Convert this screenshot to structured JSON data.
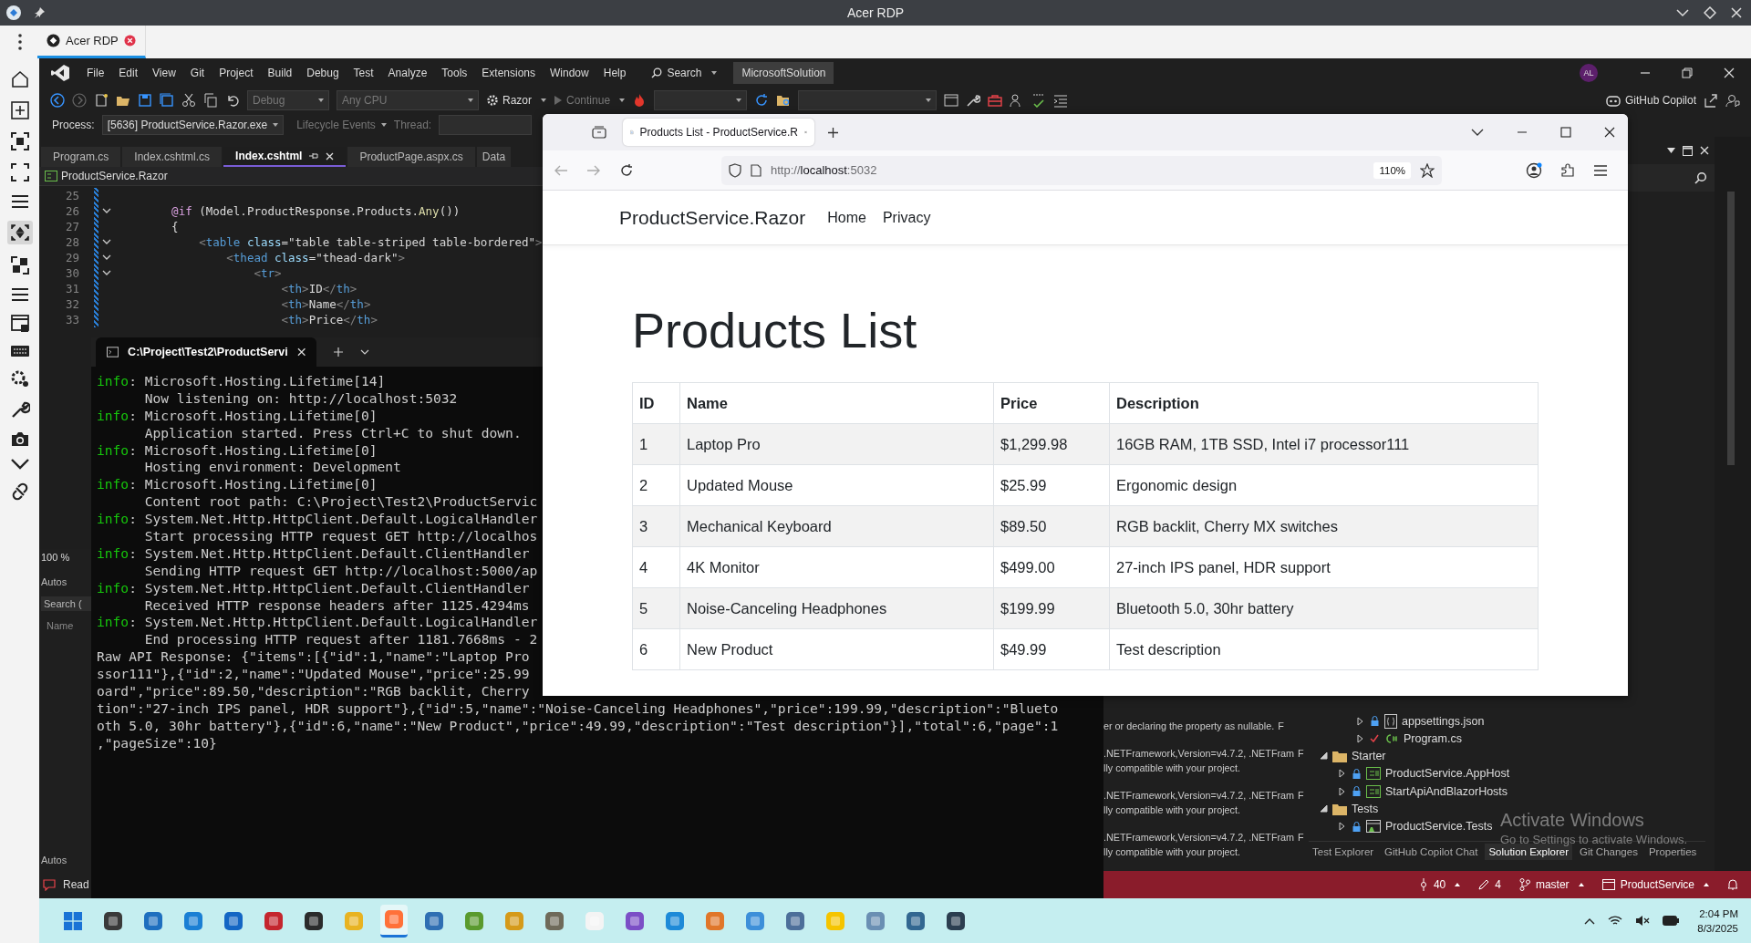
{
  "rdp": {
    "title": "Acer RDP",
    "tab": "Acer RDP"
  },
  "vs": {
    "menu": [
      "File",
      "Edit",
      "View",
      "Git",
      "Project",
      "Build",
      "Debug",
      "Test",
      "Analyze",
      "Tools",
      "Extensions",
      "Window",
      "Help"
    ],
    "search": "Search",
    "solution": "MicrosoftSolution",
    "account": "AL",
    "configuration": "Debug",
    "platform": "Any CPU",
    "startup": "Razor",
    "continue": "Continue",
    "copilot": "GitHub Copilot",
    "process_label": "Process:",
    "process": "[5636] ProductService.Razor.exe",
    "lifecycle": "Lifecycle Events",
    "thread_label": "Thread:",
    "doc_tabs": [
      {
        "label": "Program.cs",
        "selected": false
      },
      {
        "label": "Index.cshtml.cs",
        "selected": false
      },
      {
        "label": "Index.cshtml",
        "selected": true
      },
      {
        "label": "ProductPage.aspx.cs",
        "selected": false
      },
      {
        "label": "Data",
        "selected": false
      }
    ],
    "breadcrumb": "ProductService.Razor",
    "code": [
      {
        "number": "25",
        "foldable": false
      },
      {
        "number": "26",
        "foldable": true,
        "segments": [
          {
            "kind": "keyword",
            "text": "    @if"
          },
          {
            "kind": "plain",
            "text": " (Model.ProductResponse.Products."
          },
          {
            "kind": "method",
            "text": "Any"
          },
          {
            "kind": "plain",
            "text": "())"
          }
        ]
      },
      {
        "number": "27",
        "foldable": false,
        "segments": [
          {
            "kind": "plain",
            "text": "    {"
          }
        ]
      },
      {
        "number": "28",
        "foldable": true,
        "segments": [
          {
            "kind": "punct",
            "text": "        <"
          },
          {
            "kind": "tag",
            "text": "table"
          },
          {
            "kind": "attr",
            "text": " class"
          },
          {
            "kind": "plain",
            "text": "="
          },
          {
            "kind": "string",
            "text": "\"table table-striped table-bordered\""
          },
          {
            "kind": "punct",
            "text": ">"
          }
        ]
      },
      {
        "number": "29",
        "foldable": true,
        "segments": [
          {
            "kind": "punct",
            "text": "            <"
          },
          {
            "kind": "tag",
            "text": "thead"
          },
          {
            "kind": "attr",
            "text": " class"
          },
          {
            "kind": "plain",
            "text": "="
          },
          {
            "kind": "string",
            "text": "\"thead-dark\""
          },
          {
            "kind": "punct",
            "text": ">"
          }
        ]
      },
      {
        "number": "30",
        "foldable": true,
        "segments": [
          {
            "kind": "punct",
            "text": "                <"
          },
          {
            "kind": "tag",
            "text": "tr"
          },
          {
            "kind": "punct",
            "text": ">"
          }
        ]
      },
      {
        "number": "31",
        "foldable": false,
        "segments": [
          {
            "kind": "punct",
            "text": "                    <"
          },
          {
            "kind": "tag",
            "text": "th"
          },
          {
            "kind": "punct",
            "text": ">"
          },
          {
            "kind": "plain",
            "text": "ID"
          },
          {
            "kind": "punct",
            "text": "</"
          },
          {
            "kind": "tag",
            "text": "th"
          },
          {
            "kind": "punct",
            "text": ">"
          }
        ]
      },
      {
        "number": "32",
        "foldable": false,
        "segments": [
          {
            "kind": "punct",
            "text": "                    <"
          },
          {
            "kind": "tag",
            "text": "th"
          },
          {
            "kind": "punct",
            "text": ">"
          },
          {
            "kind": "plain",
            "text": "Name"
          },
          {
            "kind": "punct",
            "text": "</"
          },
          {
            "kind": "tag",
            "text": "th"
          },
          {
            "kind": "punct",
            "text": ">"
          }
        ]
      },
      {
        "number": "33",
        "foldable": false,
        "segments": [
          {
            "kind": "punct",
            "text": "                    <"
          },
          {
            "kind": "tag",
            "text": "th"
          },
          {
            "kind": "punct",
            "text": ">"
          },
          {
            "kind": "plain",
            "text": "Price"
          },
          {
            "kind": "punct",
            "text": "</"
          },
          {
            "kind": "tag",
            "text": "th"
          },
          {
            "kind": "punct",
            "text": ">"
          }
        ]
      }
    ],
    "zoom": "100 %",
    "autos": {
      "title": "Autos",
      "search": "Search (",
      "column": "Name",
      "footer_tab": "Autos"
    },
    "errors": [
      {
        "text": "er or declaring the property as nullable.",
        "column_2": "F"
      },
      {
        "text": ".NETFramework,Version=v4.7.2, .NETFram",
        "column_2": "F"
      },
      {
        "text": "lly compatible with your project."
      },
      {
        "text": ".NETFramework,Version=v4.7.2, .NETFram",
        "column_2": "F"
      },
      {
        "text": "lly compatible with your project."
      },
      {
        "text": ".NETFramework,Version=v4.7.2, .NETFram",
        "column_2": "F"
      },
      {
        "text": "lly compatible with your project."
      }
    ],
    "solution_explorer": {
      "nested_items": [
        {
          "label": "appsettings.json",
          "kind": "json",
          "locked": true,
          "modified": false,
          "expanded": false
        },
        {
          "label": "Program.cs",
          "kind": "csharp",
          "locked": false,
          "modified": true,
          "expanded": false
        }
      ],
      "tree": [
        {
          "label": "Starter",
          "kind": "folder",
          "expanded": true,
          "children": [
            {
              "label": "ProductService.AppHost",
              "kind": "project",
              "locked": true,
              "expanded": false
            },
            {
              "label": "StartApiAndBlazorHosts",
              "kind": "project",
              "locked": true,
              "expanded": false
            }
          ]
        },
        {
          "label": "Tests",
          "kind": "folder",
          "expanded": true,
          "children": [
            {
              "label": "ProductService.Tests",
              "kind": "test",
              "locked": true,
              "expanded": false
            }
          ]
        }
      ],
      "tabs": [
        {
          "label": "Test Explorer",
          "selected": false
        },
        {
          "label": "GitHub Copilot Chat",
          "selected": false
        },
        {
          "label": "Solution Explorer",
          "selected": true
        },
        {
          "label": "Git Changes",
          "selected": false
        },
        {
          "label": "Properties",
          "selected": false
        }
      ]
    },
    "status": {
      "left": "Read",
      "errors": "40",
      "edits": "4",
      "branch": "master",
      "repo": "ProductService"
    }
  },
  "terminal": {
    "tab": "C:\\Project\\Test2\\ProductServi",
    "lines": [
      {
        "kind": "log",
        "tag": "info",
        "text": ": Microsoft.Hosting.Lifetime[14]"
      },
      {
        "kind": "plain",
        "text": "      Now listening on: http://localhost:5032"
      },
      {
        "kind": "log",
        "tag": "info",
        "text": ": Microsoft.Hosting.Lifetime[0]"
      },
      {
        "kind": "plain",
        "text": "      Application started. Press Ctrl+C to shut down."
      },
      {
        "kind": "log",
        "tag": "info",
        "text": ": Microsoft.Hosting.Lifetime[0]"
      },
      {
        "kind": "plain",
        "text": "      Hosting environment: Development"
      },
      {
        "kind": "log",
        "tag": "info",
        "text": ": Microsoft.Hosting.Lifetime[0]"
      },
      {
        "kind": "plain",
        "text": "      Content root path: C:\\Project\\Test2\\ProductServic"
      },
      {
        "kind": "log",
        "tag": "info",
        "text": ": System.Net.Http.HttpClient.Default.LogicalHandler"
      },
      {
        "kind": "plain",
        "text": "      Start processing HTTP request GET http://localhos"
      },
      {
        "kind": "log",
        "tag": "info",
        "text": ": System.Net.Http.HttpClient.Default.ClientHandler"
      },
      {
        "kind": "plain",
        "text": "      Sending HTTP request GET http://localhost:5000/ap"
      },
      {
        "kind": "log",
        "tag": "info",
        "text": ": System.Net.Http.HttpClient.Default.ClientHandler"
      },
      {
        "kind": "plain",
        "text": "      Received HTTP response headers after 1125.4294ms"
      },
      {
        "kind": "log",
        "tag": "info",
        "text": ": System.Net.Http.HttpClient.Default.LogicalHandler"
      },
      {
        "kind": "plain",
        "text": "      End processing HTTP request after 1181.7668ms - 2"
      },
      {
        "kind": "plain",
        "text": "Raw API Response: {\"items\":[{\"id\":1,\"name\":\"Laptop Pro"
      },
      {
        "kind": "plain",
        "text": "ssor111\"},{\"id\":2,\"name\":\"Updated Mouse\",\"price\":25.99"
      },
      {
        "kind": "plain",
        "text": "oard\",\"price\":89.50,\"description\":\"RGB backlit, Cherry"
      },
      {
        "kind": "plain",
        "text": "tion\":\"27-inch IPS panel, HDR support\"},{\"id\":5,\"name\":\"Noise-Canceling Headphones\",\"price\":199.99,\"description\":\"Blueto"
      },
      {
        "kind": "plain",
        "text": "oth 5.0, 30hr battery\"},{\"id\":6,\"name\":\"New Product\",\"price\":49.99,\"description\":\"Test description\"}],\"total\":6,\"page\":1"
      },
      {
        "kind": "plain",
        "text": ",\"pageSize\":10}"
      }
    ]
  },
  "browser": {
    "tab": "Products List - ProductService.R",
    "url_scheme": "http://",
    "url_host": "localhost",
    "url_port": ":5032",
    "zoom": "110%",
    "brand": "ProductService.Razor",
    "nav": [
      "Home",
      "Privacy"
    ],
    "heading": "Products List",
    "table": {
      "columns": [
        "ID",
        "Name",
        "Price",
        "Description"
      ],
      "rows": [
        [
          "1",
          "Laptop Pro",
          "$1,299.98",
          "16GB RAM, 1TB SSD, Intel i7 processor111"
        ],
        [
          "2",
          "Updated Mouse",
          "$25.99",
          "Ergonomic design"
        ],
        [
          "3",
          "Mechanical Keyboard",
          "$89.50",
          "RGB backlit, Cherry MX switches"
        ],
        [
          "4",
          "4K Monitor",
          "$499.00",
          "27-inch IPS panel, HDR support"
        ],
        [
          "5",
          "Noise-Canceling Headphones",
          "$199.99",
          "Bluetooth 5.0, 30hr battery"
        ],
        [
          "6",
          "New Product",
          "$49.99",
          "Test description"
        ]
      ]
    }
  },
  "activate": {
    "title": "Activate Windows",
    "subtitle": "Go to Settings to activate Windows."
  },
  "taskbar": {
    "apps": [
      {
        "selected": false
      },
      {
        "selected": false
      },
      {
        "selected": false
      },
      {
        "selected": false
      },
      {
        "selected": false
      },
      {
        "selected": false
      },
      {
        "selected": false
      },
      {
        "selected": true
      },
      {
        "selected": false
      },
      {
        "selected": false
      },
      {
        "selected": false
      },
      {
        "selected": false
      },
      {
        "selected": false
      },
      {
        "selected": false
      },
      {
        "selected": false
      },
      {
        "selected": false
      },
      {
        "selected": false
      },
      {
        "selected": false
      },
      {
        "selected": false
      },
      {
        "selected": false
      },
      {
        "selected": false
      },
      {
        "selected": false
      }
    ],
    "time": "2:04 PM",
    "date": "8/3/2025"
  }
}
